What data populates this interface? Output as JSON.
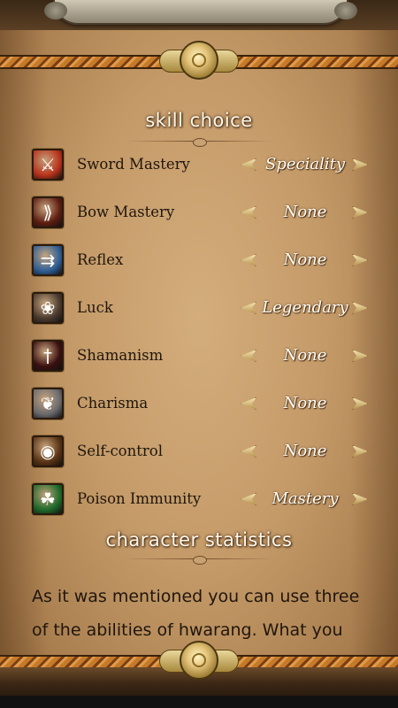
{
  "header": {
    "skill_title": "skill choice",
    "stats_title": "character statistics"
  },
  "skills": [
    {
      "name": "Sword Mastery",
      "level": "Speciality",
      "icon": "sword-mastery-icon",
      "color": "#b8321b"
    },
    {
      "name": "Bow Mastery",
      "level": "None",
      "icon": "bow-mastery-icon",
      "color": "#5e1d10"
    },
    {
      "name": "Reflex",
      "level": "None",
      "icon": "reflex-icon",
      "color": "#2f5f95"
    },
    {
      "name": "Luck",
      "level": "Legendary",
      "icon": "luck-icon",
      "color": "#4a3a2e"
    },
    {
      "name": "Shamanism",
      "level": "None",
      "icon": "shamanism-icon",
      "color": "#3a0f0f"
    },
    {
      "name": "Charisma",
      "level": "None",
      "icon": "charisma-icon",
      "color": "#6b6a6e"
    },
    {
      "name": "Self-control",
      "level": "None",
      "icon": "self-control-icon",
      "color": "#5a3414"
    },
    {
      "name": "Poison Immunity",
      "level": "Mastery",
      "icon": "poison-immunity-icon",
      "color": "#1f6a2b"
    }
  ],
  "description": "As it was mentioned you can use three of the abilities of hwarang. What you"
}
